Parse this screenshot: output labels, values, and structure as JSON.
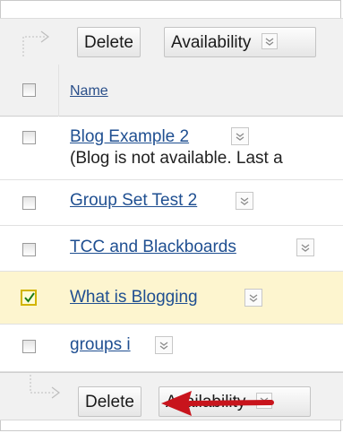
{
  "toolbar_top": {
    "delete_label": "Delete",
    "availability_label": "Availability"
  },
  "table": {
    "header": {
      "name_label": "Name"
    },
    "rows": [
      {
        "title": "Blog Example 2",
        "subtitle": "(Blog is not available. Last a",
        "checked": false
      },
      {
        "title": "Group Set Test 2",
        "checked": false
      },
      {
        "title": "TCC and Blackboards",
        "checked": false
      },
      {
        "title": "What is Blogging",
        "checked": true
      },
      {
        "title": "groups i",
        "checked": false
      }
    ]
  },
  "toolbar_bottom": {
    "delete_label": "Delete",
    "availability_label": "Availability"
  },
  "colors": {
    "link": "#1f4f91",
    "selected_row": "#fdf5cf",
    "annotation_arrow": "#c8141c"
  }
}
